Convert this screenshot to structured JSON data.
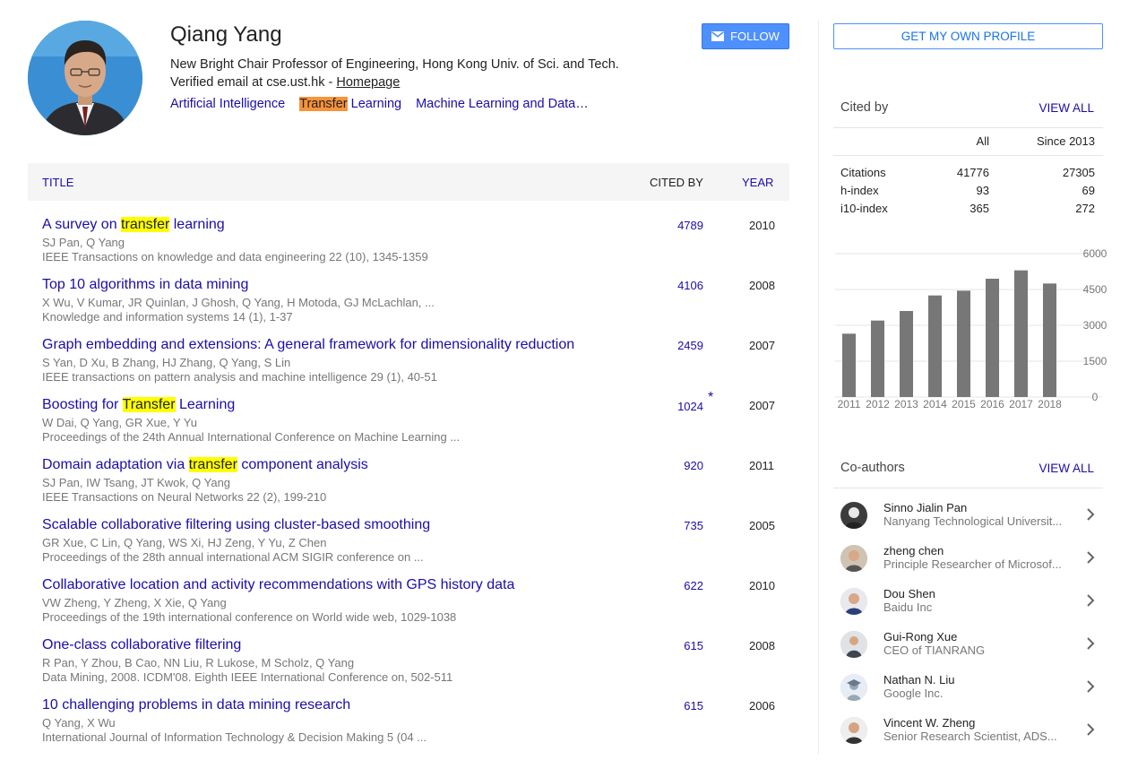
{
  "profile": {
    "name": "Qiang Yang",
    "affiliation": "New Bright Chair Professor of Engineering, Hong Kong Univ. of Sci. and Tech.",
    "email_text": "Verified email at cse.ust.hk - ",
    "homepage_label": "Homepage",
    "interests": {
      "ai": "Artificial Intelligence",
      "tl_hl": "Transfer",
      "tl_rest": " Learning",
      "ml": "Machine Learning and Data…"
    },
    "follow_label": "FOLLOW"
  },
  "table": {
    "title_header": "TITLE",
    "cited_header": "CITED BY",
    "year_header": "YEAR",
    "rows": [
      {
        "t_pre": "A survey on ",
        "t_hl": "transfer",
        "t_post": " learning",
        "authors": "SJ Pan, Q Yang",
        "venue": "IEEE Transactions on knowledge and data engineering 22 (10), 1345-1359",
        "cited": "4789",
        "year": "2010"
      },
      {
        "t_pre": "Top 10 algorithms in data mining",
        "t_hl": "",
        "t_post": "",
        "authors": "X Wu, V Kumar, JR Quinlan, J Ghosh, Q Yang, H Motoda, GJ McLachlan, ...",
        "venue": "Knowledge and information systems 14 (1), 1-37",
        "cited": "4106",
        "year": "2008"
      },
      {
        "t_pre": "Graph embedding and extensions: A general framework for dimensionality reduction",
        "t_hl": "",
        "t_post": "",
        "authors": "S Yan, D Xu, B Zhang, HJ Zhang, Q Yang, S Lin",
        "venue": "IEEE transactions on pattern analysis and machine intelligence 29 (1), 40-51",
        "cited": "2459",
        "year": "2007"
      },
      {
        "t_pre": "Boosting for ",
        "t_hl": "Transfer",
        "t_post": " Learning",
        "authors": "W Dai, Q Yang, GR Xue, Y Yu",
        "venue": "Proceedings of the 24th Annual International Conference on Machine Learning ...",
        "cited": "1024",
        "star": "*",
        "year": "2007"
      },
      {
        "t_pre": "Domain adaptation via ",
        "t_hl": "transfer",
        "t_post": " component analysis",
        "authors": "SJ Pan, IW Tsang, JT Kwok, Q Yang",
        "venue": "IEEE Transactions on Neural Networks 22 (2), 199-210",
        "cited": "920",
        "year": "2011"
      },
      {
        "t_pre": "Scalable collaborative filtering using cluster-based smoothing",
        "t_hl": "",
        "t_post": "",
        "authors": "GR Xue, C Lin, Q Yang, WS Xi, HJ Zeng, Y Yu, Z Chen",
        "venue": "Proceedings of the 28th annual international ACM SIGIR conference on ...",
        "cited": "735",
        "year": "2005"
      },
      {
        "t_pre": "Collaborative location and activity recommendations with GPS history data",
        "t_hl": "",
        "t_post": "",
        "authors": "VW Zheng, Y Zheng, X Xie, Q Yang",
        "venue": "Proceedings of the 19th international conference on World wide web, 1029-1038",
        "cited": "622",
        "year": "2010"
      },
      {
        "t_pre": "One-class collaborative filtering",
        "t_hl": "",
        "t_post": "",
        "authors": "R Pan, Y Zhou, B Cao, NN Liu, R Lukose, M Scholz, Q Yang",
        "venue": "Data Mining, 2008. ICDM'08. Eighth IEEE International Conference on, 502-511",
        "cited": "615",
        "year": "2008"
      },
      {
        "t_pre": "10 challenging problems in data mining research",
        "t_hl": "",
        "t_post": "",
        "authors": "Q Yang, X Wu",
        "venue": "International Journal of Information Technology & Decision Making 5 (04 ...",
        "cited": "615",
        "year": "2006"
      }
    ]
  },
  "sidebar": {
    "get_profile_label": "GET MY OWN PROFILE",
    "cited_by": {
      "title": "Cited by",
      "view_all": "VIEW ALL",
      "col_all": "All",
      "col_since": "Since 2013",
      "stats": [
        {
          "label": "Citations",
          "all": "41776",
          "since": "27305"
        },
        {
          "label": "h-index",
          "all": "93",
          "since": "69"
        },
        {
          "label": "i10-index",
          "all": "365",
          "since": "272"
        }
      ]
    },
    "coauthors": {
      "title": "Co-authors",
      "view_all": "VIEW ALL",
      "list": [
        {
          "name": "Sinno Jialin Pan",
          "affil": "Nanyang Technological Universit..."
        },
        {
          "name": "zheng chen",
          "affil": "Principle Researcher of Microsof..."
        },
        {
          "name": "Dou Shen",
          "affil": "Baidu Inc"
        },
        {
          "name": "Gui-Rong Xue",
          "affil": "CEO of TIANRANG"
        },
        {
          "name": "Nathan N. Liu",
          "affil": "Google Inc."
        },
        {
          "name": "Vincent W. Zheng",
          "affil": "Senior Research Scientist, ADS..."
        }
      ]
    }
  },
  "chart_data": {
    "type": "bar",
    "categories": [
      "2011",
      "2012",
      "2013",
      "2014",
      "2015",
      "2016",
      "2017",
      "2018"
    ],
    "values": [
      2650,
      3200,
      3600,
      4250,
      4450,
      4950,
      5300,
      4750
    ],
    "yticks": [
      "6000",
      "4500",
      "3000",
      "1500",
      "0"
    ],
    "ylim": [
      0,
      6000
    ],
    "bar_color": "#777777"
  },
  "colors": {
    "link": "#1a0dab",
    "follow_bg": "#4d90fe",
    "highlight": "#ffff00",
    "highlight_orange": "#f7933a"
  }
}
